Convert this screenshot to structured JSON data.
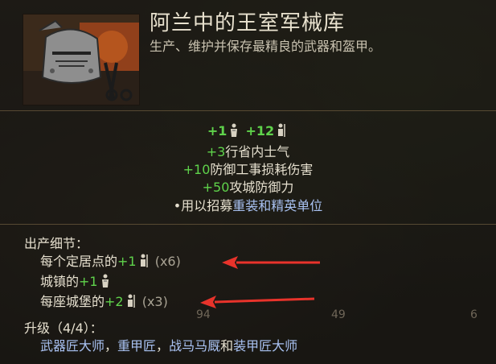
{
  "building": {
    "title": "阿兰中的王室军械库",
    "subtitle": "生产、维护并保存最精良的武器和盔甲。"
  },
  "top_bonus": {
    "a": "+1",
    "b": "+12"
  },
  "effects": [
    {
      "value": "+3",
      "text": "行省内士气"
    },
    {
      "value": "+10",
      "text": "防御工事损耗伤害"
    },
    {
      "value": "+50",
      "text": "攻城防御力"
    }
  ],
  "recruit_line": {
    "prefix": "•用以招募",
    "highlight": "重装和精英单位"
  },
  "production": {
    "header": "出产细节：",
    "rows": [
      {
        "label": "每个定居点的",
        "value": "+1",
        "count": "(x6)"
      },
      {
        "label": "城镇的",
        "value": "+1",
        "count": ""
      },
      {
        "label": "每座城堡的",
        "value": "+2",
        "count": "(x3)"
      }
    ]
  },
  "upgrades": {
    "header": "升级（4/4）：",
    "items": [
      "武器匠大师",
      "重甲匠",
      "战马马厩",
      "装甲匠大师"
    ],
    "sep1": "，",
    "sep2": "，",
    "and": "和"
  },
  "background_numbers": [
    "94",
    "49",
    "6"
  ],
  "colors": {
    "positive": "#5fd34b",
    "link": "#a9c2f2",
    "arrow": "#e8332b"
  }
}
